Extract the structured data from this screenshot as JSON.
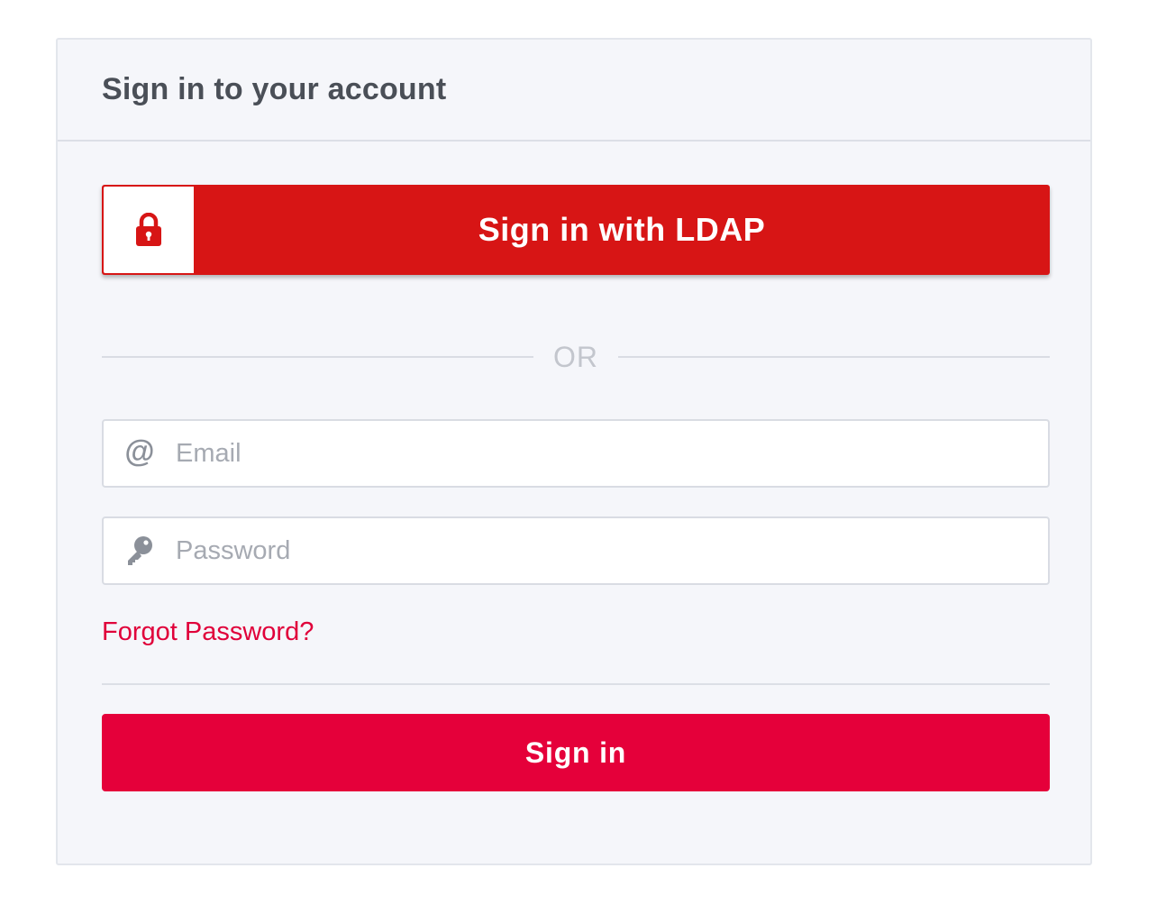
{
  "login_card": {
    "title": "Sign in to your account",
    "ldap_button": {
      "label": "Sign in with LDAP",
      "icon": "lock-icon",
      "color": "#d71515"
    },
    "divider_text": "OR",
    "email_field": {
      "icon": "at-sign-icon",
      "icon_glyph": "@",
      "placeholder": "Email",
      "value": ""
    },
    "password_field": {
      "icon": "key-icon",
      "placeholder": "Password",
      "value": ""
    },
    "forgot_password_link": "Forgot Password?",
    "sign_in_button": {
      "label": "Sign in",
      "color": "#e5003a"
    }
  }
}
